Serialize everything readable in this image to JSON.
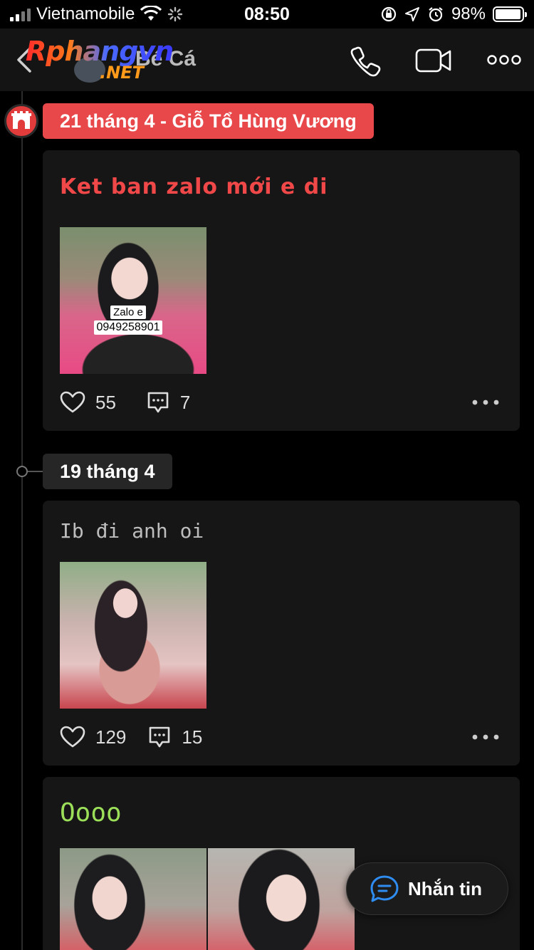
{
  "status_bar": {
    "carrier": "Vietnamobile",
    "time": "08:50",
    "battery": "98%",
    "battery_level": 0.98
  },
  "nav": {
    "watermark_main": "Rphangvn",
    "watermark_sub": ".NET",
    "contact_name": "Bé Cá"
  },
  "timeline": [
    {
      "date_label": "21 tháng 4 - Giỗ Tổ Hùng Vương",
      "posts": [
        {
          "text": "Ket ban zalo mới e di",
          "photo_overlay": [
            "Zalo e",
            "0949258901"
          ],
          "likes": "55",
          "comments": "7"
        }
      ]
    },
    {
      "date_label": "19 tháng 4",
      "posts": [
        {
          "text": "Ib đi anh oi",
          "likes": "129",
          "comments": "15"
        },
        {
          "text": "Oooo"
        }
      ]
    }
  ],
  "message_button": {
    "label": "Nhắn tin"
  },
  "icons": {
    "back": "chevron-left-icon",
    "call": "phone-icon",
    "video": "video-camera-icon",
    "more": "more-horizontal-icon",
    "like": "heart-icon",
    "comment": "comment-icon",
    "holiday": "temple-gate-icon",
    "message": "chat-bubble-icon"
  },
  "colors": {
    "holiday_pill": "#e8484a",
    "post1_text": "#f04848",
    "post3_text": "#9ce05a",
    "message_icon": "#2f8cf0"
  }
}
